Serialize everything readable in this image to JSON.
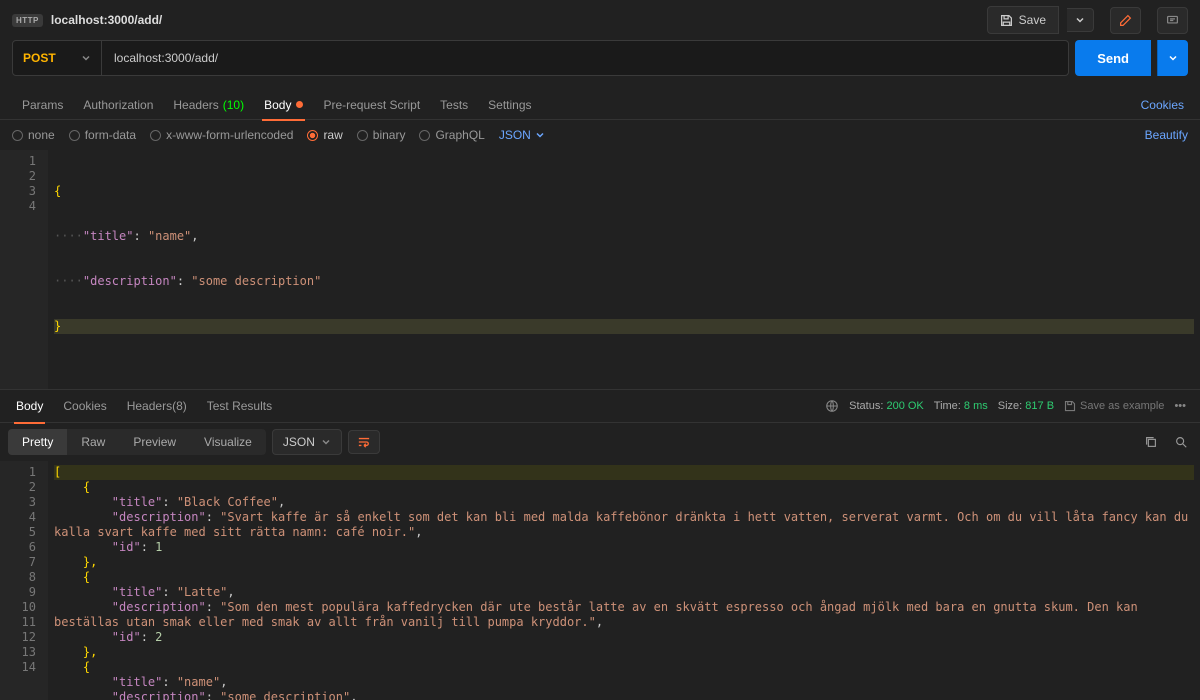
{
  "topbar": {
    "badge": "HTTP",
    "title": "localhost:3000/add/",
    "save": "Save"
  },
  "request": {
    "method": "POST",
    "url": "localhost:3000/add/"
  },
  "send": "Send",
  "tabs": {
    "params": "Params",
    "authorization": "Authorization",
    "headers": "Headers",
    "headers_count": "(10)",
    "body": "Body",
    "prerequest": "Pre-request Script",
    "tests": "Tests",
    "settings": "Settings",
    "cookies": "Cookies"
  },
  "bodytype": {
    "none": "none",
    "formdata": "form-data",
    "urlencoded": "x-www-form-urlencoded",
    "raw": "raw",
    "binary": "binary",
    "graphql": "GraphQL",
    "json": "JSON",
    "beautify": "Beautify"
  },
  "req_body": {
    "lines": [
      "1",
      "2",
      "3",
      "4"
    ],
    "l1_open": "{",
    "l2_k": "\"title\"",
    "l2_v": "\"name\"",
    "l3_k": "\"description\"",
    "l3_v": "\"some description\"",
    "l4_close": "}"
  },
  "response": {
    "tabs": {
      "body": "Body",
      "cookies": "Cookies",
      "headers": "Headers",
      "headers_count": "(8)",
      "testresults": "Test Results"
    },
    "status_label": "Status:",
    "status_value": "200 OK",
    "time_label": "Time:",
    "time_value": "8 ms",
    "size_label": "Size:",
    "size_value": "817 B",
    "save_example": "Save as example"
  },
  "resp_toolbar": {
    "pretty": "Pretty",
    "raw": "Raw",
    "preview": "Preview",
    "visualize": "Visualize",
    "json": "JSON"
  },
  "resp_body": {
    "lines": [
      "1",
      "2",
      "3",
      "4",
      "5",
      "6",
      "7",
      "8",
      "9",
      "10",
      "11",
      "12",
      "13",
      "14"
    ],
    "l1": "[",
    "l2": "{",
    "l3_k": "\"title\"",
    "l3_v": "\"Black Coffee\"",
    "l4_k": "\"description\"",
    "l4_v": "\"Svart kaffe är så enkelt som det kan bli med malda kaffebönor dränkta i hett vatten, serverat varmt. Och om du vill låta fancy kan du kalla svart kaffe med sitt rätta namn: café noir.\"",
    "l5_k": "\"id\"",
    "l5_v": "1",
    "l6": "},",
    "l7": "{",
    "l8_k": "\"title\"",
    "l8_v": "\"Latte\"",
    "l9_k": "\"description\"",
    "l9_v": "\"Som den mest populära kaffedrycken där ute består latte av en skvätt espresso och ångad mjölk med bara en gnutta skum. Den kan beställas utan smak eller med smak av allt från vanilj till pumpa kryddor.\"",
    "l10_k": "\"id\"",
    "l10_v": "2",
    "l11": "},",
    "l12": "{",
    "l13_k": "\"title\"",
    "l13_v": "\"name\"",
    "l14_k": "\"description\"",
    "l14_v": "\"some description\""
  }
}
